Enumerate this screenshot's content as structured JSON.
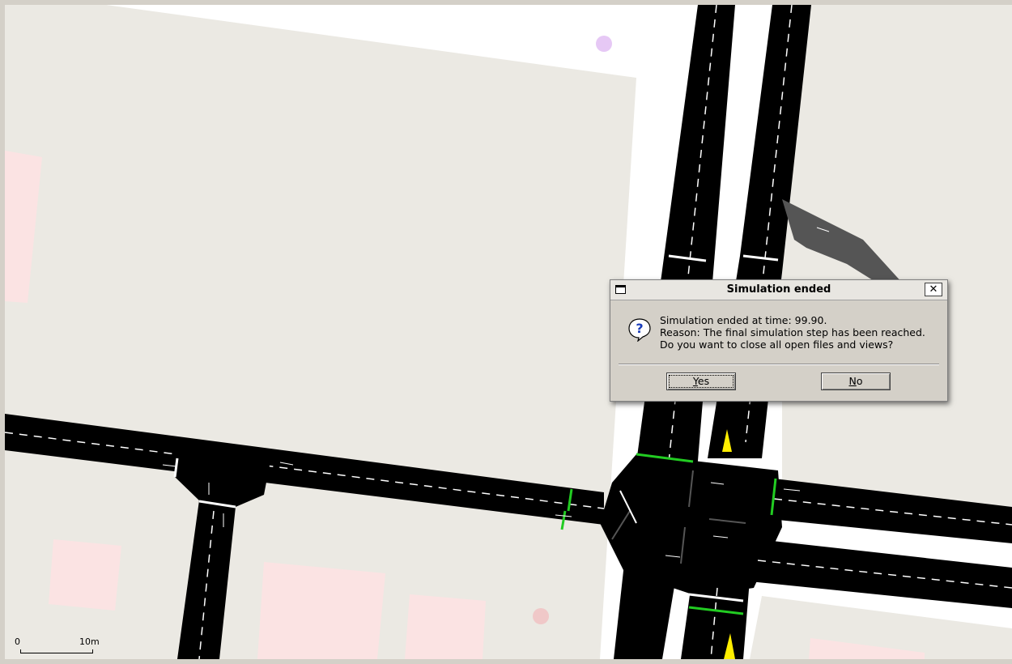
{
  "map": {
    "scale_bar": {
      "zero_label": "0",
      "distance_label": "10m"
    },
    "colors": {
      "background": "#ffffff",
      "land": "#ebe9e3",
      "buildings": "#fbe3e3",
      "road": "#000000",
      "ramp": "#555555",
      "green_signal": "#22cc22",
      "vehicle": "#ffee00",
      "poi_purple": "#e6c8f5",
      "poi_red": "#f0c8c8"
    }
  },
  "dialog": {
    "title": "Simulation ended",
    "close_label": "✕",
    "icon": "question-icon",
    "message_lines": [
      "Simulation ended at time: 99.90.",
      "Reason: The final simulation step has been reached.",
      "Do you want to close all open files and views?"
    ],
    "yes": {
      "mnemonic": "Y",
      "rest": "es"
    },
    "no": {
      "mnemonic": "N",
      "rest": "o"
    }
  }
}
